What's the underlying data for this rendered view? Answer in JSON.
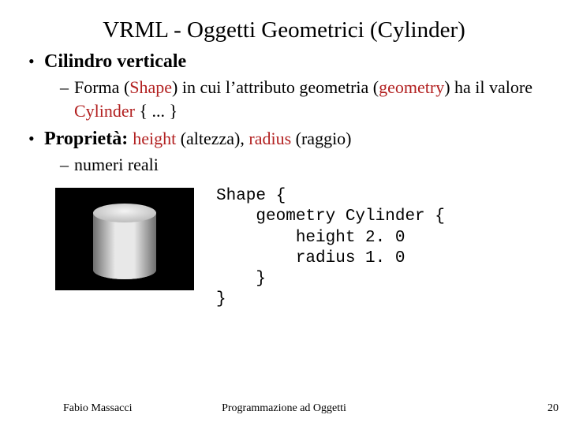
{
  "title": "VRML - Oggetti Geometrici (Cylinder)",
  "b1": {
    "label": "Cilindro verticale",
    "sub": {
      "pre1": "Forma (",
      "kw1": "Shape",
      "mid1": ") in cui l’attributo geometria (",
      "kw2": "geometry",
      "post1": ") ha il valore ",
      "kw3": "Cylinder",
      "post2": " { ... }"
    }
  },
  "b2": {
    "label": "Proprietà:",
    "kw1": "height",
    "txt1": " (altezza), ",
    "kw2": "radius",
    "txt2": " (raggio)",
    "sub": "numeri reali"
  },
  "code": "Shape {\n    geometry Cylinder {\n        height 2. 0\n        radius 1. 0\n    }\n}",
  "footer": {
    "left": "Fabio Massacci",
    "center": "Programmazione ad Oggetti",
    "page": "20"
  }
}
